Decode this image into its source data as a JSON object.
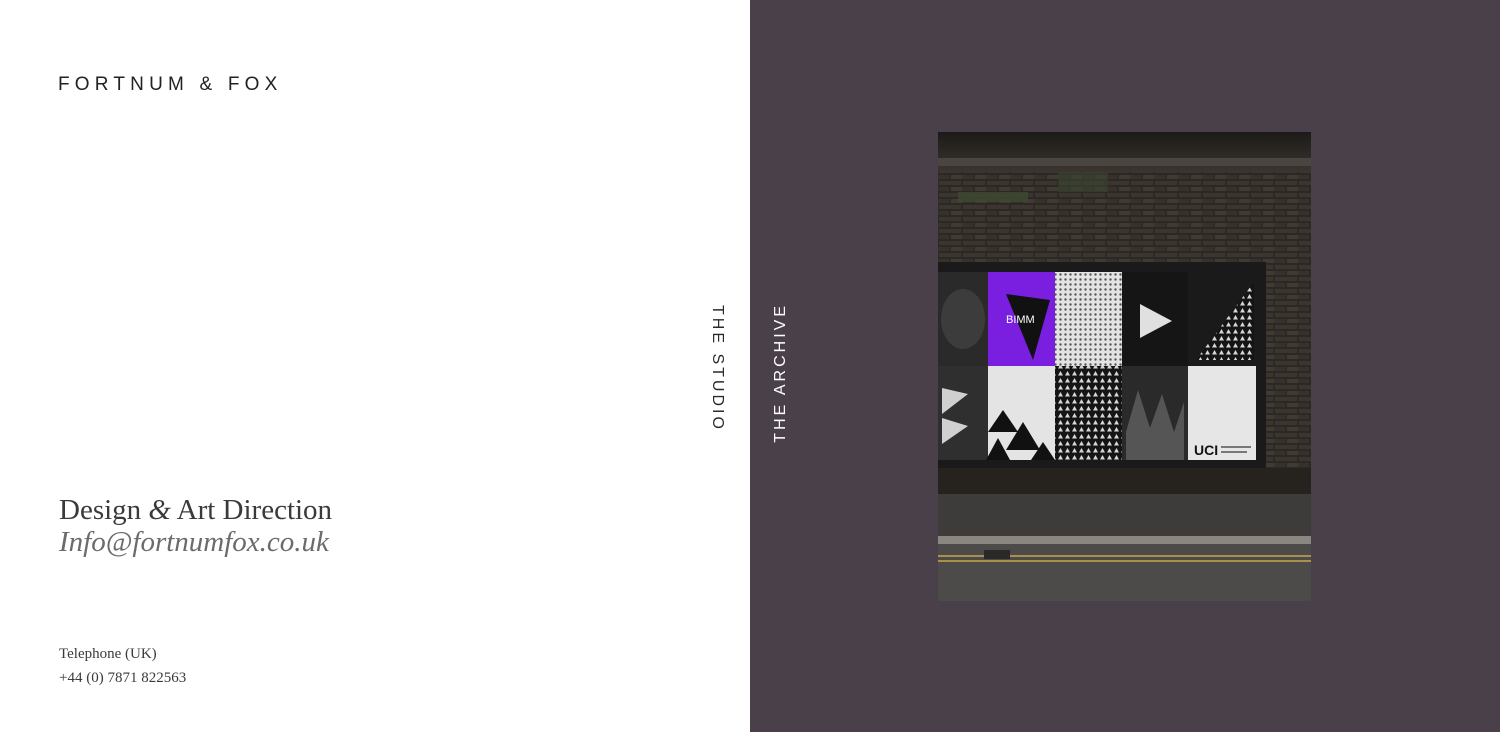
{
  "brand": {
    "logo_text": "FORTNUM & FOX"
  },
  "intro": {
    "tagline_part1": "Design ",
    "tagline_amp": "&",
    "tagline_part2": " Art Direction",
    "email": "Info@fortnumfox.co.uk"
  },
  "contact": {
    "telephone_label": "Telephone (UK)",
    "telephone_number": "+44 (0) 7871 822563"
  },
  "navigation": {
    "studio_label": "THE STUDIO",
    "archive_label": "THE ARCHIVE"
  },
  "feature": {
    "poster_label_1": "BIMM",
    "poster_label_2": "UCI"
  },
  "colors": {
    "archive_panel": "#4a404a",
    "accent_purple": "#7a1fe0",
    "text_dark": "#3a3a3a",
    "text_muted": "#6b6b6b"
  }
}
